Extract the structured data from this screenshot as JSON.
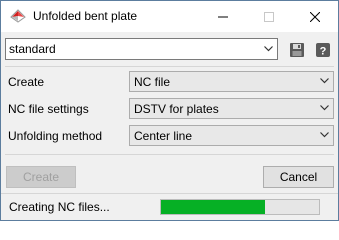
{
  "window": {
    "title": "Unfolded bent plate",
    "icon": "unfolded-plate-app-icon"
  },
  "preset": {
    "value": "standard",
    "save_icon": "save-icon",
    "help_icon": "help-icon"
  },
  "fields": [
    {
      "label": "Create",
      "value": "NC file"
    },
    {
      "label": "NC file settings",
      "value": "DSTV for plates"
    },
    {
      "label": "Unfolding method",
      "value": "Center line"
    }
  ],
  "buttons": {
    "create_label": "Create",
    "cancel_label": "Cancel"
  },
  "status": {
    "text": "Creating NC files...",
    "progress": 0.66,
    "progress_color": "#06b025"
  }
}
